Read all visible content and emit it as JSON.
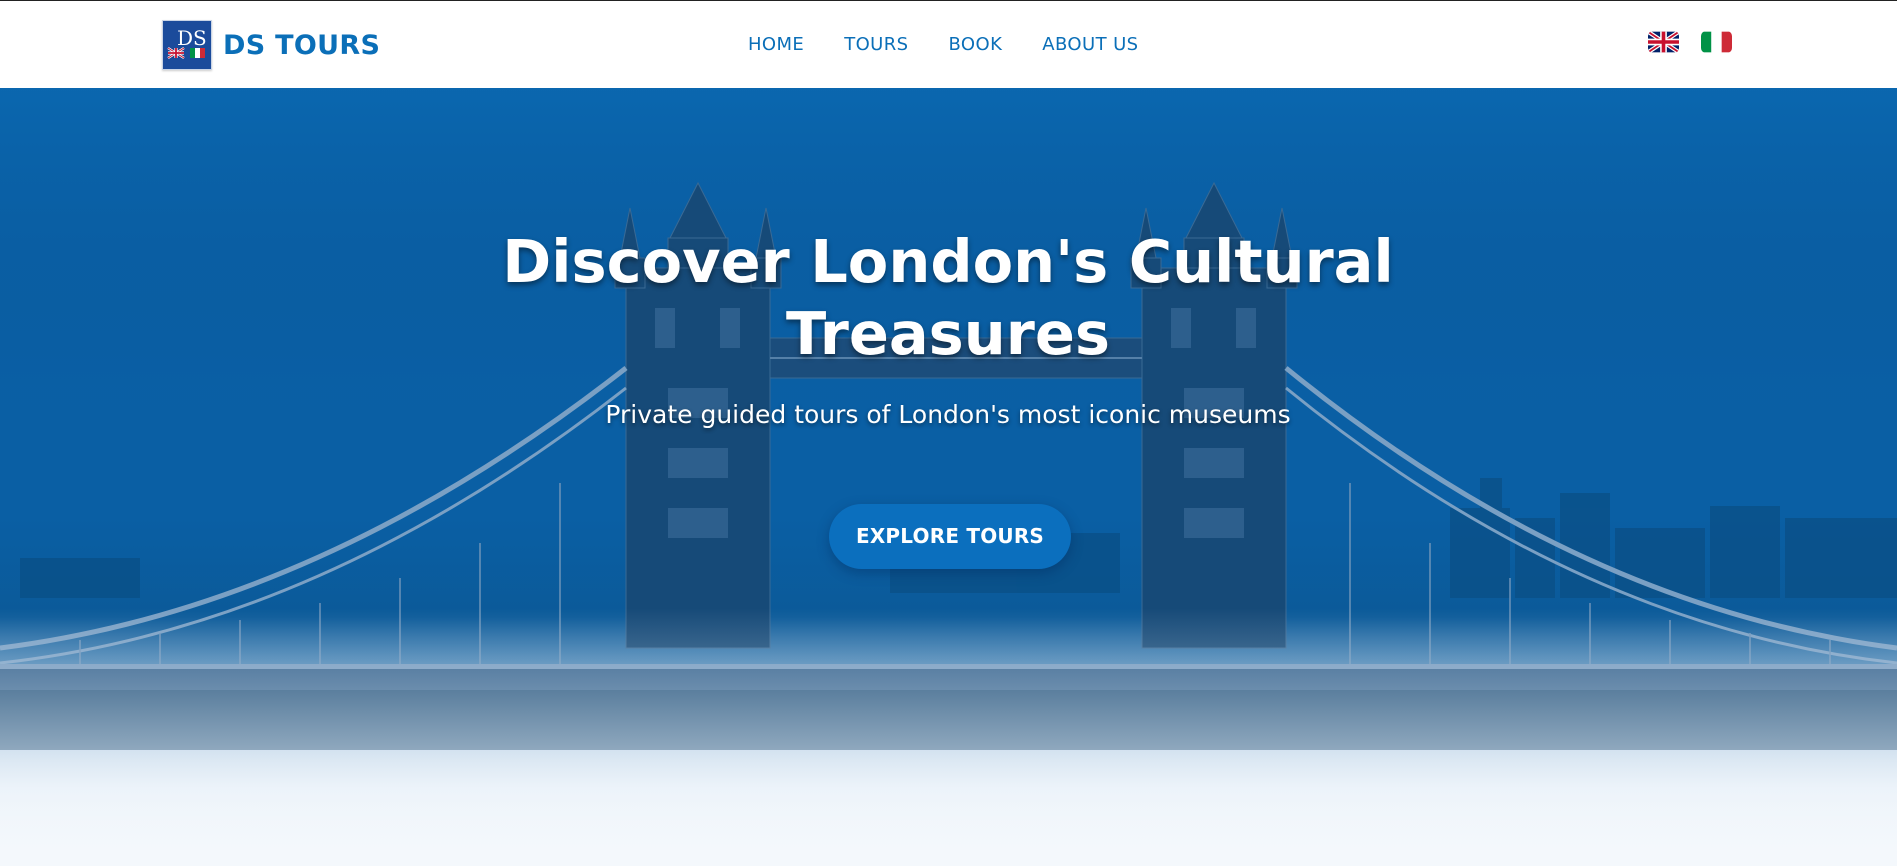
{
  "brand": {
    "name": "DS TOURS",
    "logo_letters": "DS",
    "primary_color": "#0b6fb8",
    "logo_bg": "#1b4b9b"
  },
  "nav": {
    "items": [
      {
        "label": "HOME"
      },
      {
        "label": "TOURS"
      },
      {
        "label": "BOOK"
      },
      {
        "label": "ABOUT US"
      }
    ]
  },
  "languages": [
    {
      "code": "en",
      "icon": "uk-flag-icon"
    },
    {
      "code": "it",
      "icon": "italy-flag-icon"
    }
  ],
  "hero": {
    "title_line1": "Discover London's Cultural",
    "title_line2": "Treasures",
    "subtitle": "Private guided tours of London's most iconic museums",
    "cta_label": "EXPLORE TOURS",
    "background": "tower-bridge-image",
    "overlay_color": "#0a5fa6"
  }
}
